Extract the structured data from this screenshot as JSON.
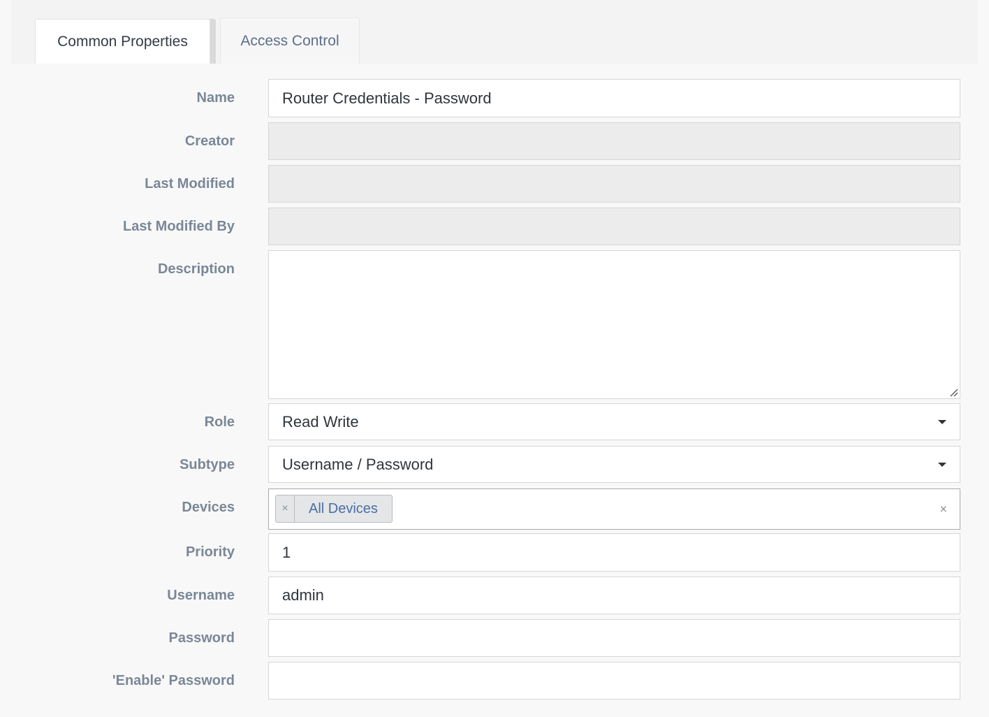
{
  "tabs": [
    {
      "label": "Common Properties",
      "active": true
    },
    {
      "label": "Access Control",
      "active": false
    }
  ],
  "fields": {
    "name": {
      "label": "Name",
      "value": "Router Credentials - Password"
    },
    "creator": {
      "label": "Creator",
      "value": ""
    },
    "last_modified": {
      "label": "Last Modified",
      "value": ""
    },
    "last_modified_by": {
      "label": "Last Modified By",
      "value": ""
    },
    "description": {
      "label": "Description",
      "value": ""
    },
    "role": {
      "label": "Role",
      "value": "Read Write"
    },
    "subtype": {
      "label": "Subtype",
      "value": "Username / Password"
    },
    "devices": {
      "label": "Devices",
      "tags": [
        "All Devices"
      ],
      "tag_remove_glyph": "×",
      "clear_glyph": "×"
    },
    "priority": {
      "label": "Priority",
      "value": "1"
    },
    "username": {
      "label": "Username",
      "value": "admin"
    },
    "password": {
      "label": "Password",
      "value": ""
    },
    "enable_password": {
      "label": "'Enable' Password",
      "value": ""
    }
  },
  "colors": {
    "label": "#7a8797",
    "tag_text": "#4a6ea3",
    "inactive_tab_text": "#5c6f8a",
    "disabled_field": "#ececec"
  }
}
